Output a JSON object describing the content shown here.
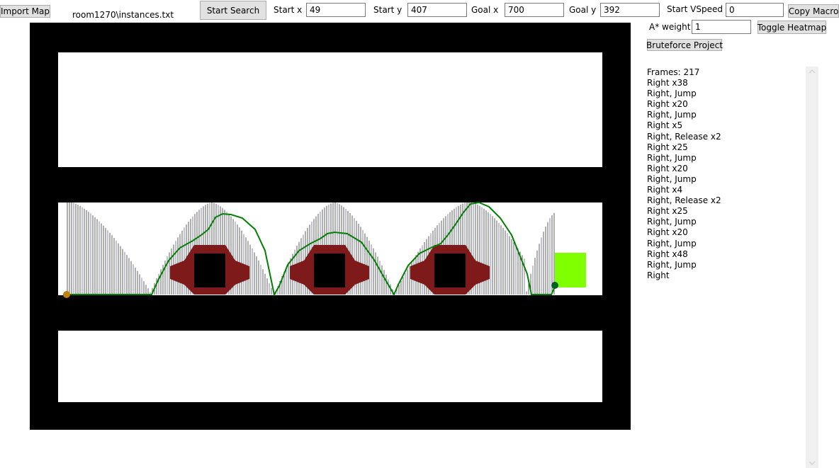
{
  "toolbar": {
    "import_map_label": "Import Map",
    "file_path": "room1270\\instances.txt",
    "start_search_label": "Start Search",
    "copy_macro_label": "Copy Macro",
    "toggle_heatmap_label": "Toggle Heatmap",
    "bruteforce_label": "Bruteforce Project"
  },
  "params": {
    "start_x_label": "Start x",
    "start_x": "49",
    "start_y_label": "Start y",
    "start_y": "407",
    "goal_x_label": "Goal x",
    "goal_x": "700",
    "goal_y_label": "Goal y",
    "goal_y": "392",
    "start_vspeed_label": "Start VSpeed",
    "start_vspeed": "0",
    "astar_weight_label": "A* weight",
    "astar_weight": "1"
  },
  "output_lines": [
    "Frames: 217",
    "Right x38",
    "Right, Jump",
    "Right x20",
    "Right, Jump",
    "Right x5",
    "Right, Release x2",
    "Right x25",
    "Right, Jump",
    "Right x20",
    "Right, Jump",
    "Right x4",
    "Right, Release x2",
    "Right x25",
    "Right, Jump",
    "Right x20",
    "Right, Jump",
    "Right x48",
    "Right, Jump",
    "Right"
  ],
  "colors": {
    "wall": "#000000",
    "room": "#ffffff",
    "spike": "#7f1a1a",
    "block": "#000000",
    "goal": "#80ff00",
    "path": "#008000",
    "trace": "#1a1a1a",
    "trace_alt": "#4a4a8a",
    "start_marker": "#c08000",
    "end_marker": "#006020"
  },
  "icons": {
    "scroll_up": "chevron-up-icon",
    "scroll_down": "chevron-down-icon"
  }
}
